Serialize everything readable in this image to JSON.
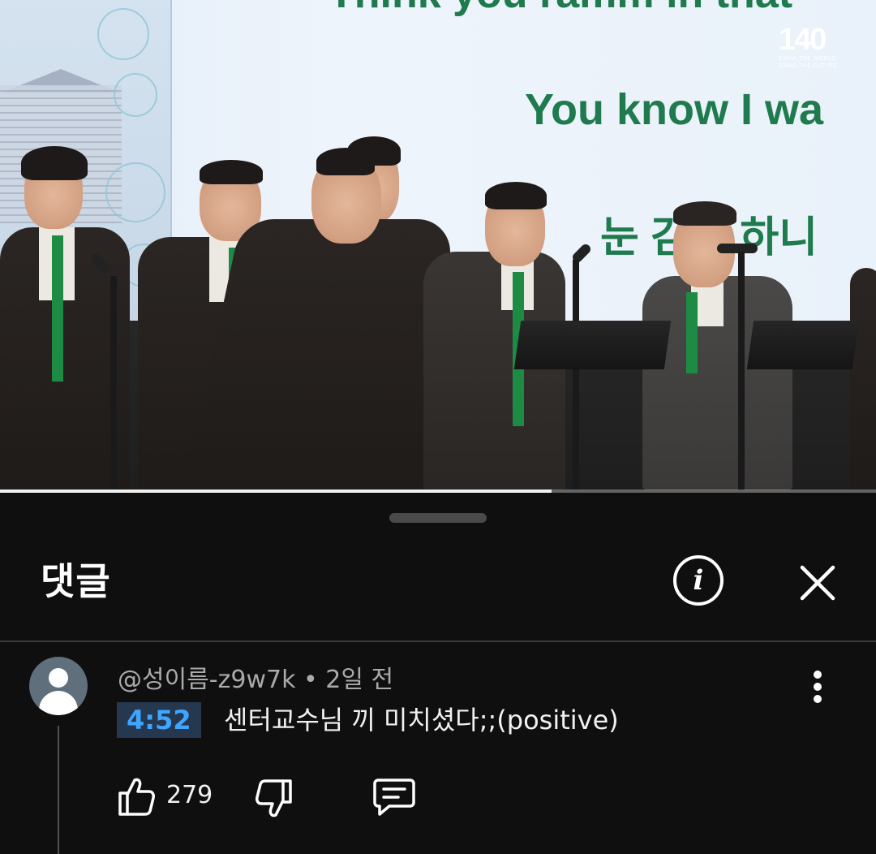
{
  "video": {
    "lyrics": {
      "line_top": "Think you ramm in that",
      "line_mid": "You know I wa",
      "line_low": "눈 감고 하니"
    },
    "logo": {
      "number": "140",
      "sub_line1": "EWHA THE WORLD",
      "sub_line2": "EWHA THE FUTURE"
    },
    "progress_fraction": 0.63
  },
  "comments_panel": {
    "title": "댓글",
    "info_icon": "info-icon",
    "close_icon": "close-icon"
  },
  "comment": {
    "author": "@성이름-z9w7k",
    "separator": " • ",
    "time_ago": "2일 전",
    "timestamp_link": "4:52",
    "text": "센터교수님 끼 미치셨다;;(positive)",
    "like_count": "279",
    "icons": {
      "like": "thumbs-up-icon",
      "dislike": "thumbs-down-icon",
      "reply": "reply-icon",
      "more": "more-vertical-icon",
      "avatar": "default-avatar-icon"
    }
  },
  "colors": {
    "background": "#0f0f0f",
    "timestamp_link": "#3ea6ff",
    "lyric_green": "#1f7a4d",
    "tie_green": "#1e8b45"
  }
}
